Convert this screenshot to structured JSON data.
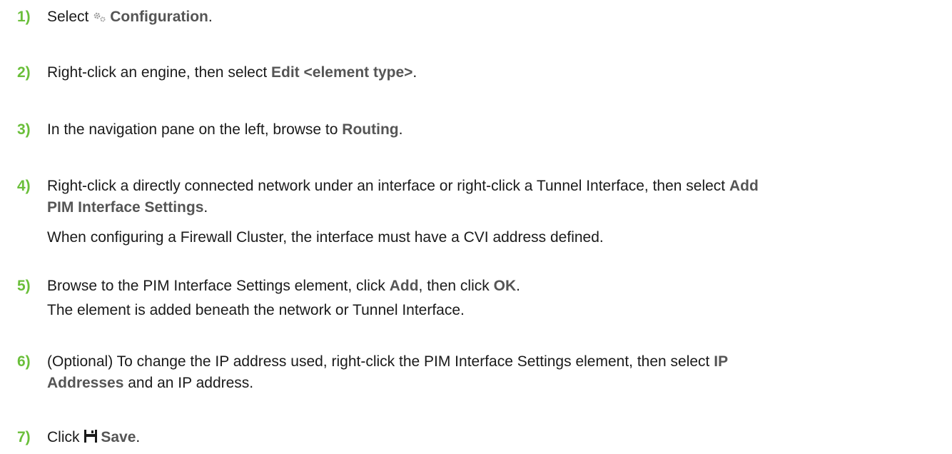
{
  "steps": [
    {
      "number": "1)",
      "pre": "Select",
      "ui": "Configuration",
      "post": ".",
      "icon": "gears-icon"
    },
    {
      "number": "2)",
      "pre": "Right-click an engine, then select",
      "ui": "Edit <element type>",
      "post": "."
    },
    {
      "number": "3)",
      "pre": "In the navigation pane on the left, browse to",
      "ui": "Routing",
      "post": "."
    },
    {
      "number": "4)",
      "pre": "Right-click a directly connected network under an interface or right-click a Tunnel Interface, then select",
      "ui_line1": "Add",
      "ui_line2": "PIM Interface Settings",
      "post": ".",
      "note": "When configuring a Firewall Cluster, the interface must have a CVI address defined."
    },
    {
      "number": "5)",
      "pre": "Browse to the PIM Interface Settings element, click",
      "ui1": "Add",
      "mid": ", then click",
      "ui2": "OK",
      "post": ".",
      "note": "The element is added beneath the network or Tunnel Interface."
    },
    {
      "number": "6)",
      "pre": "(Optional) To change the IP address used, right-click the PIM Interface Settings element, then select",
      "ui_line1": "IP",
      "ui_line2": "Addresses",
      "post": " and an IP address."
    },
    {
      "number": "7)",
      "pre": "Click",
      "ui": "Save",
      "post": ".",
      "icon": "save-icon"
    }
  ],
  "colors": {
    "step_number": "#6abf3a",
    "ui_term": "#555555",
    "text": "#1a1a1a"
  }
}
